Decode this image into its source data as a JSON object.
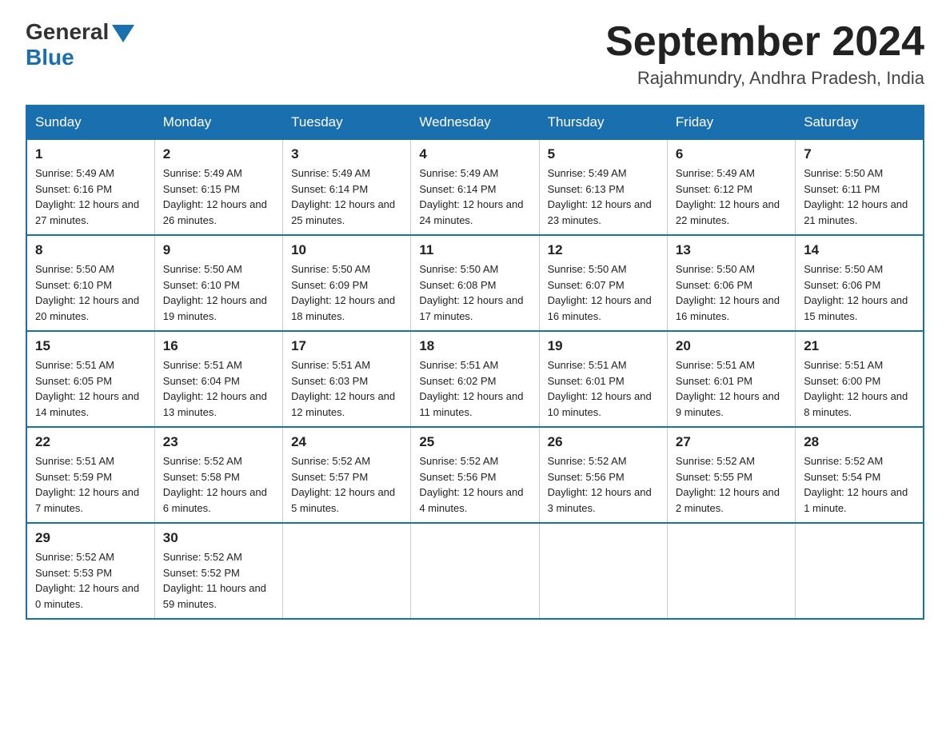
{
  "header": {
    "logo_general": "General",
    "logo_blue": "Blue",
    "month_title": "September 2024",
    "location": "Rajahmundry, Andhra Pradesh, India"
  },
  "columns": [
    "Sunday",
    "Monday",
    "Tuesday",
    "Wednesday",
    "Thursday",
    "Friday",
    "Saturday"
  ],
  "weeks": [
    [
      {
        "day": "1",
        "sunrise": "5:49 AM",
        "sunset": "6:16 PM",
        "daylight": "12 hours and 27 minutes."
      },
      {
        "day": "2",
        "sunrise": "5:49 AM",
        "sunset": "6:15 PM",
        "daylight": "12 hours and 26 minutes."
      },
      {
        "day": "3",
        "sunrise": "5:49 AM",
        "sunset": "6:14 PM",
        "daylight": "12 hours and 25 minutes."
      },
      {
        "day": "4",
        "sunrise": "5:49 AM",
        "sunset": "6:14 PM",
        "daylight": "12 hours and 24 minutes."
      },
      {
        "day": "5",
        "sunrise": "5:49 AM",
        "sunset": "6:13 PM",
        "daylight": "12 hours and 23 minutes."
      },
      {
        "day": "6",
        "sunrise": "5:49 AM",
        "sunset": "6:12 PM",
        "daylight": "12 hours and 22 minutes."
      },
      {
        "day": "7",
        "sunrise": "5:50 AM",
        "sunset": "6:11 PM",
        "daylight": "12 hours and 21 minutes."
      }
    ],
    [
      {
        "day": "8",
        "sunrise": "5:50 AM",
        "sunset": "6:10 PM",
        "daylight": "12 hours and 20 minutes."
      },
      {
        "day": "9",
        "sunrise": "5:50 AM",
        "sunset": "6:10 PM",
        "daylight": "12 hours and 19 minutes."
      },
      {
        "day": "10",
        "sunrise": "5:50 AM",
        "sunset": "6:09 PM",
        "daylight": "12 hours and 18 minutes."
      },
      {
        "day": "11",
        "sunrise": "5:50 AM",
        "sunset": "6:08 PM",
        "daylight": "12 hours and 17 minutes."
      },
      {
        "day": "12",
        "sunrise": "5:50 AM",
        "sunset": "6:07 PM",
        "daylight": "12 hours and 16 minutes."
      },
      {
        "day": "13",
        "sunrise": "5:50 AM",
        "sunset": "6:06 PM",
        "daylight": "12 hours and 16 minutes."
      },
      {
        "day": "14",
        "sunrise": "5:50 AM",
        "sunset": "6:06 PM",
        "daylight": "12 hours and 15 minutes."
      }
    ],
    [
      {
        "day": "15",
        "sunrise": "5:51 AM",
        "sunset": "6:05 PM",
        "daylight": "12 hours and 14 minutes."
      },
      {
        "day": "16",
        "sunrise": "5:51 AM",
        "sunset": "6:04 PM",
        "daylight": "12 hours and 13 minutes."
      },
      {
        "day": "17",
        "sunrise": "5:51 AM",
        "sunset": "6:03 PM",
        "daylight": "12 hours and 12 minutes."
      },
      {
        "day": "18",
        "sunrise": "5:51 AM",
        "sunset": "6:02 PM",
        "daylight": "12 hours and 11 minutes."
      },
      {
        "day": "19",
        "sunrise": "5:51 AM",
        "sunset": "6:01 PM",
        "daylight": "12 hours and 10 minutes."
      },
      {
        "day": "20",
        "sunrise": "5:51 AM",
        "sunset": "6:01 PM",
        "daylight": "12 hours and 9 minutes."
      },
      {
        "day": "21",
        "sunrise": "5:51 AM",
        "sunset": "6:00 PM",
        "daylight": "12 hours and 8 minutes."
      }
    ],
    [
      {
        "day": "22",
        "sunrise": "5:51 AM",
        "sunset": "5:59 PM",
        "daylight": "12 hours and 7 minutes."
      },
      {
        "day": "23",
        "sunrise": "5:52 AM",
        "sunset": "5:58 PM",
        "daylight": "12 hours and 6 minutes."
      },
      {
        "day": "24",
        "sunrise": "5:52 AM",
        "sunset": "5:57 PM",
        "daylight": "12 hours and 5 minutes."
      },
      {
        "day": "25",
        "sunrise": "5:52 AM",
        "sunset": "5:56 PM",
        "daylight": "12 hours and 4 minutes."
      },
      {
        "day": "26",
        "sunrise": "5:52 AM",
        "sunset": "5:56 PM",
        "daylight": "12 hours and 3 minutes."
      },
      {
        "day": "27",
        "sunrise": "5:52 AM",
        "sunset": "5:55 PM",
        "daylight": "12 hours and 2 minutes."
      },
      {
        "day": "28",
        "sunrise": "5:52 AM",
        "sunset": "5:54 PM",
        "daylight": "12 hours and 1 minute."
      }
    ],
    [
      {
        "day": "29",
        "sunrise": "5:52 AM",
        "sunset": "5:53 PM",
        "daylight": "12 hours and 0 minutes."
      },
      {
        "day": "30",
        "sunrise": "5:52 AM",
        "sunset": "5:52 PM",
        "daylight": "11 hours and 59 minutes."
      },
      null,
      null,
      null,
      null,
      null
    ]
  ]
}
